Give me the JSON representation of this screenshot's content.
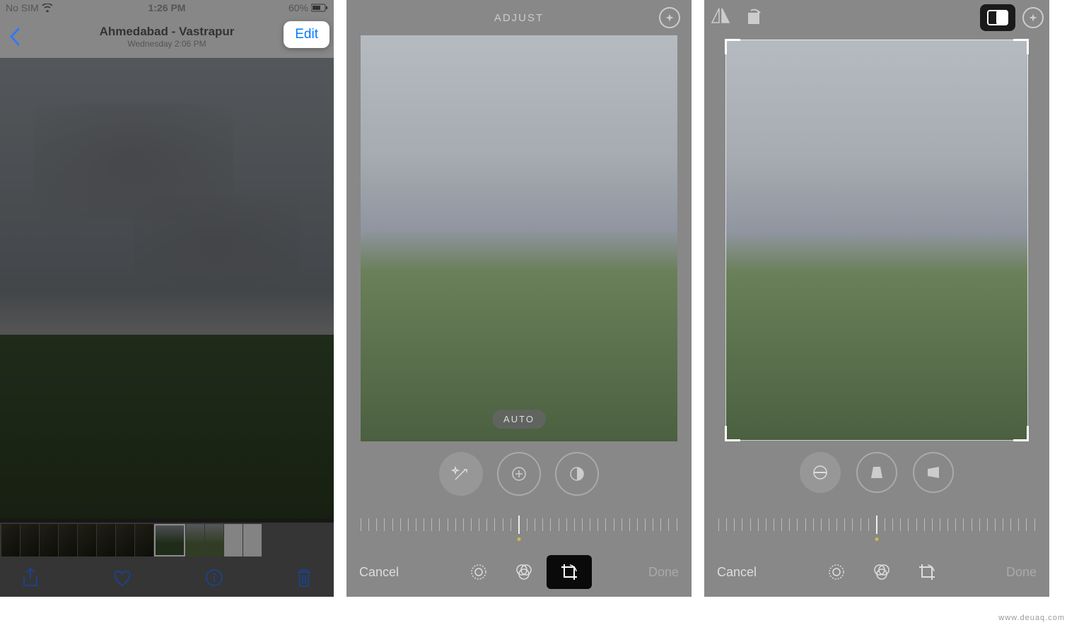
{
  "screen1": {
    "status": {
      "carrier": "No SIM",
      "time": "1:26 PM",
      "battery": "60%"
    },
    "nav": {
      "title": "Ahmedabad - Vastrapur",
      "subtitle": "Wednesday  2:06 PM",
      "edit": "Edit"
    }
  },
  "screen2": {
    "title": "ADJUST",
    "auto": "AUTO",
    "cancel": "Cancel",
    "done": "Done"
  },
  "screen3": {
    "cancel": "Cancel",
    "done": "Done"
  },
  "watermark": "www.deuaq.com"
}
